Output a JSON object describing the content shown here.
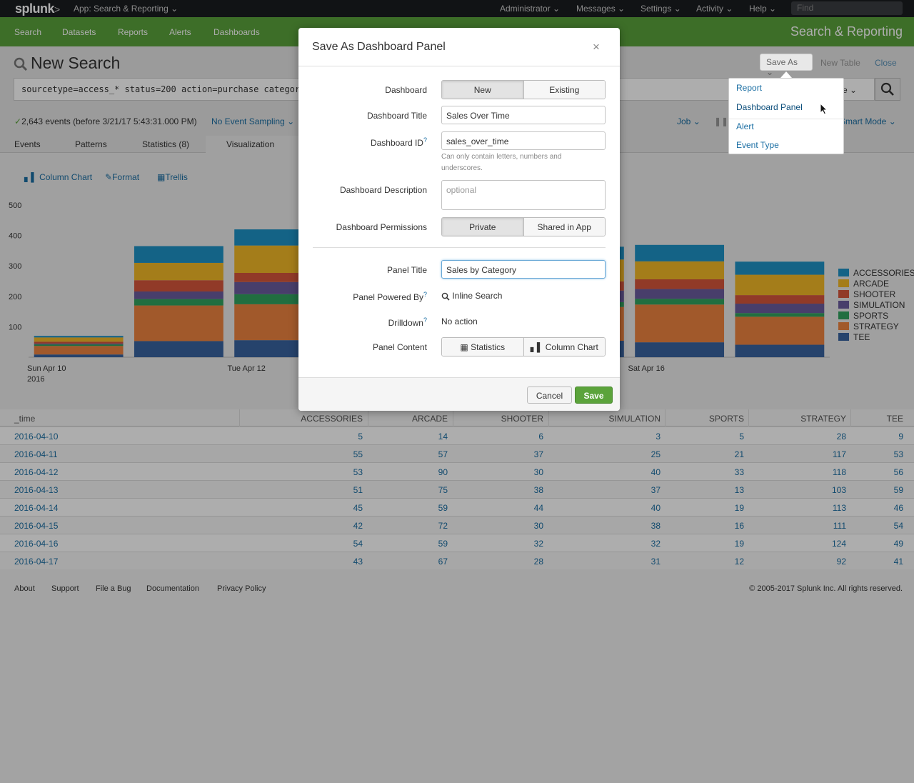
{
  "topbar": {
    "logo": "splunk",
    "logo_chevron": ">",
    "app": "App: Search & Reporting",
    "menus": [
      "Administrator",
      "Messages",
      "Settings",
      "Activity",
      "Help"
    ],
    "find_placeholder": "Find"
  },
  "appbar": {
    "nav": [
      "Search",
      "Datasets",
      "Reports",
      "Alerts",
      "Dashboards"
    ],
    "title": "Search & Reporting"
  },
  "search": {
    "title": "New Search",
    "query": "sourcetype=access_* status=200 action=purchase categoryId!=NULL | timechart count by categoryId",
    "time_picker": "me",
    "save_as": "Save As",
    "new_table": "New Table",
    "close": "Close",
    "events": "2,643 events (before 3/21/17 5:43:31.000 PM)",
    "sampling": "No Event Sampling",
    "job": "Job",
    "mode": "Smart Mode"
  },
  "tabs": [
    "Events",
    "Patterns",
    "Statistics (8)",
    "Visualization"
  ],
  "viz_toolbar": [
    "Column Chart",
    "Format",
    "Trellis"
  ],
  "chart_data": {
    "type": "bar",
    "stacked": true,
    "x": [
      "2016-04-10",
      "2016-04-11",
      "2016-04-12",
      "2016-04-13",
      "2016-04-14",
      "2016-04-15",
      "2016-04-16",
      "2016-04-17"
    ],
    "x_tick_labels": [
      {
        "index": 0,
        "line1": "Sun Apr 10",
        "line2": "2016"
      },
      {
        "index": 2,
        "line1": "Tue Apr 12",
        "line2": ""
      },
      {
        "index": 6,
        "line1": "Sat Apr 16",
        "line2": ""
      }
    ],
    "y_ticks": [
      100,
      200,
      300,
      400,
      500
    ],
    "ylim": [
      0,
      500
    ],
    "legend_position": "right",
    "series": [
      {
        "name": "ACCESSORIES",
        "color": "#1e93c6",
        "values": [
          5,
          55,
          53,
          51,
          45,
          42,
          54,
          43
        ]
      },
      {
        "name": "ARCADE",
        "color": "#f2b827",
        "values": [
          14,
          57,
          90,
          75,
          59,
          72,
          59,
          67
        ]
      },
      {
        "name": "SHOOTER",
        "color": "#d6563c",
        "values": [
          6,
          37,
          30,
          38,
          44,
          30,
          32,
          28
        ]
      },
      {
        "name": "SIMULATION",
        "color": "#6a5c9e",
        "values": [
          3,
          25,
          40,
          37,
          40,
          38,
          32,
          31
        ]
      },
      {
        "name": "SPORTS",
        "color": "#31a35f",
        "values": [
          5,
          21,
          33,
          13,
          19,
          16,
          19,
          12
        ]
      },
      {
        "name": "STRATEGY",
        "color": "#ed8440",
        "values": [
          28,
          117,
          118,
          103,
          113,
          111,
          124,
          92
        ]
      },
      {
        "name": "TEE",
        "color": "#3863a0",
        "values": [
          9,
          53,
          56,
          59,
          46,
          54,
          49,
          41
        ]
      }
    ]
  },
  "table": {
    "columns": [
      "_time",
      "ACCESSORIES",
      "ARCADE",
      "SHOOTER",
      "SIMULATION",
      "SPORTS",
      "STRATEGY",
      "TEE"
    ],
    "rows": [
      [
        "2016-04-10",
        "5",
        "14",
        "6",
        "3",
        "5",
        "28",
        "9"
      ],
      [
        "2016-04-11",
        "55",
        "57",
        "37",
        "25",
        "21",
        "117",
        "53"
      ],
      [
        "2016-04-12",
        "53",
        "90",
        "30",
        "40",
        "33",
        "118",
        "56"
      ],
      [
        "2016-04-13",
        "51",
        "75",
        "38",
        "37",
        "13",
        "103",
        "59"
      ],
      [
        "2016-04-14",
        "45",
        "59",
        "44",
        "40",
        "19",
        "113",
        "46"
      ],
      [
        "2016-04-15",
        "42",
        "72",
        "30",
        "38",
        "16",
        "111",
        "54"
      ],
      [
        "2016-04-16",
        "54",
        "59",
        "32",
        "32",
        "19",
        "124",
        "49"
      ],
      [
        "2016-04-17",
        "43",
        "67",
        "28",
        "31",
        "12",
        "92",
        "41"
      ]
    ]
  },
  "footer": {
    "links": [
      "About",
      "Support",
      "File a Bug",
      "Documentation",
      "Privacy Policy"
    ],
    "copyright": "© 2005-2017 Splunk Inc. All rights reserved."
  },
  "save_as_menu": [
    "Report",
    "Dashboard Panel",
    "Alert",
    "Event Type"
  ],
  "modal": {
    "title": "Save As Dashboard Panel",
    "close": "×",
    "dashboard_label": "Dashboard",
    "dashboard_options": [
      "New",
      "Existing"
    ],
    "dashboard_title_label": "Dashboard Title",
    "dashboard_title_value": "Sales Over Time",
    "dashboard_id_label": "Dashboard ID",
    "dashboard_id_value": "sales_over_time",
    "dashboard_id_help": "Can only contain letters, numbers and underscores.",
    "description_label": "Dashboard Description",
    "description_placeholder": "optional",
    "permissions_label": "Dashboard Permissions",
    "permissions_options": [
      "Private",
      "Shared in App"
    ],
    "panel_title_label": "Panel Title",
    "panel_title_value": "Sales by Category",
    "powered_by_label": "Panel Powered By",
    "powered_by_value": "Inline Search",
    "drilldown_label": "Drilldown",
    "drilldown_value": "No action",
    "content_label": "Panel Content",
    "content_options": [
      "Statistics",
      "Column Chart"
    ],
    "help_mark": "?",
    "cancel": "Cancel",
    "save": "Save"
  }
}
